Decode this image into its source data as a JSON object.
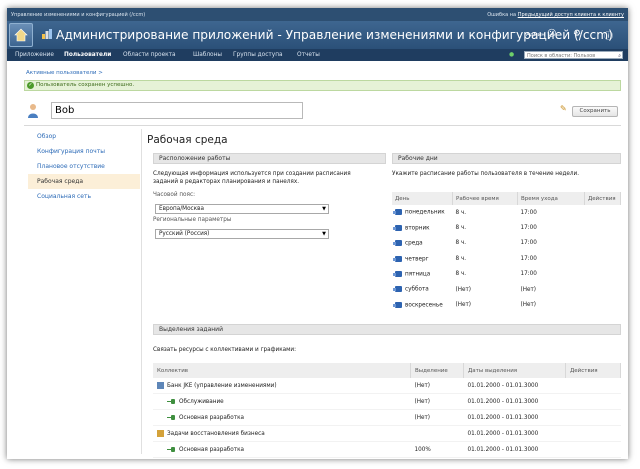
{
  "topbar": {
    "left": "Управление изменениями и конфигурацией (/ccm)",
    "right_prefix": "Ошибка на",
    "right_link": "Предыдущий доступ клиента к клиенту"
  },
  "titlebar": {
    "title": "Администрирование приложений - Управление изменениями и конфигурацией (/ccm)",
    "user": "Админ"
  },
  "nav": {
    "items": [
      "Приложение",
      "Пользователи",
      "Области проекта",
      "Шаблоны",
      "Группы доступа",
      "Отчеты"
    ],
    "search_placeholder": "Поиск в области: Пользов"
  },
  "breadcrumb": "Активные пользователи >",
  "success_message": "Пользователь сохранен успешно.",
  "user_name": "Bob",
  "save_label": "Сохранить",
  "left_nav": [
    "Обзор",
    "Конфигурация почты",
    "Плановое отсутствие",
    "Рабочая среда",
    "Социальная сеть"
  ],
  "page_title": "Рабочая среда",
  "location": {
    "header": "Расположение работы",
    "description": [
      "Следующая информация используется при создании расписания",
      "заданий в редакторах планирования и панелях."
    ],
    "timezone_label": "Часовой пояс:",
    "timezone_value": "Европа/Москва",
    "regional_label": "Региональные параметры",
    "regional_value": "Русский (Россия)"
  },
  "workdays": {
    "header": "Рабочие дни",
    "description": "Укажите расписание работы пользователя в течение недели.",
    "columns": [
      "День",
      "Рабочее время",
      "Время ухода",
      "Действия"
    ],
    "rows": [
      {
        "day": "понедельник",
        "hours": "8 ч.",
        "leave": "17:00"
      },
      {
        "day": "вторник",
        "hours": "8 ч.",
        "leave": "17:00"
      },
      {
        "day": "среда",
        "hours": "8 ч.",
        "leave": "17:00"
      },
      {
        "day": "четверг",
        "hours": "8 ч.",
        "leave": "17:00"
      },
      {
        "day": "пятница",
        "hours": "8 ч.",
        "leave": "17:00"
      },
      {
        "day": "суббота",
        "hours": "(Нет)",
        "leave": "(Нет)"
      },
      {
        "day": "воскресенье",
        "hours": "(Нет)",
        "leave": "(Нет)"
      }
    ]
  },
  "allocations": {
    "header": "Выделения заданий",
    "description": "Связать ресурсы с коллективами и графиками:",
    "columns": [
      "Коллектив",
      "Выделение",
      "Даты выделения",
      "Действия"
    ],
    "rows": [
      {
        "name": "Банк JKE (управление изменениями)",
        "alloc": "(Нет)",
        "dates": "01.01.2000 - 01.01.3000"
      },
      {
        "name": "Обслуживание",
        "alloc": "(Нет)",
        "dates": "01.01.2000 - 01.01.3000"
      },
      {
        "name": "Основная разработка",
        "alloc": "(Нет)",
        "dates": "01.01.2000 - 01.01.3000"
      },
      {
        "name": "Задачи восстановления бизнеса",
        "alloc": "",
        "dates": "01.01.2000 - 01.01.3000"
      },
      {
        "name": "Основная разработка",
        "alloc": "100%",
        "dates": "01.01.2000 - 01.01.3000"
      }
    ]
  }
}
